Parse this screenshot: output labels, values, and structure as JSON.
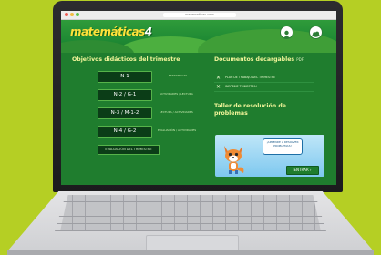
{
  "browser": {
    "url": "matematicas.com"
  },
  "header": {
    "logo": "matemáticas",
    "logo_number": "4",
    "logo_sub": "",
    "icon_left_label": "",
    "icon_right_label": ""
  },
  "objectives": {
    "title": "Objetivos didácticos del trimestre",
    "items": [
      {
        "label": "N-1",
        "note": "ESTRATEGIAS"
      },
      {
        "label": "N-2 / G-1",
        "note": "ACTIVIDADES / LECTURA"
      },
      {
        "label": "N-3 / M-1-2",
        "note": "LECTURA / ACTIVIDADES"
      },
      {
        "label": "N-4 / G-2",
        "note": "EVALUACIÓN / ACTIVIDADES"
      }
    ],
    "bottom_button": "EVALUACIÓN DEL TRIMESTRE"
  },
  "documents": {
    "title": "Documentos decargables",
    "title_suffix": "PDF",
    "items": [
      {
        "icon": "x-icon",
        "text": "PLAN DE TRABAJO DEL TRIMESTRE"
      },
      {
        "icon": "x-icon",
        "text": "INFORME TRIMESTRAL"
      }
    ]
  },
  "workshop": {
    "title_line1": "Taller de resolución de",
    "title_line2": "problemas",
    "bubble": "¡APRENDE A RESOLVER PROBLEMAS!",
    "button": "ENTRAR"
  },
  "colors": {
    "page_bg": "#b5cf24",
    "screen_bg": "#1f7d2e",
    "title_yellow": "#f2f59a",
    "pill_bg": "#0b3d17"
  }
}
